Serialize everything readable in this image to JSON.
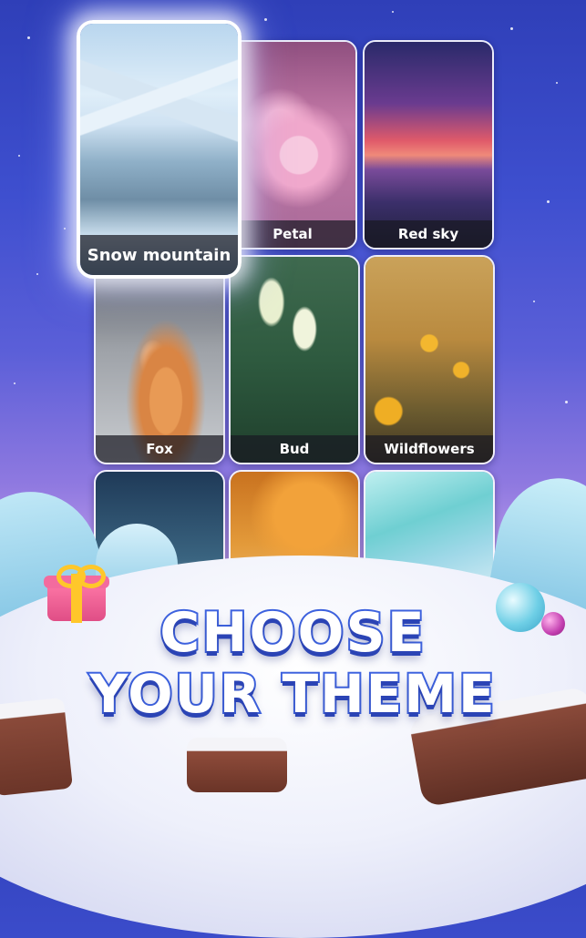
{
  "themes": [
    {
      "label": "Snow mountain",
      "selected": true
    },
    {
      "label": "Petal",
      "selected": false
    },
    {
      "label": "Red sky",
      "selected": false
    },
    {
      "label": "Fox",
      "selected": false
    },
    {
      "label": "Bud",
      "selected": false
    },
    {
      "label": "Wildflowers",
      "selected": false
    },
    {
      "label": "",
      "selected": false
    },
    {
      "label": "",
      "selected": false
    },
    {
      "label": "",
      "selected": false
    }
  ],
  "headline": {
    "line1": "CHOOSE",
    "line2": "YOUR THEME"
  },
  "colors": {
    "background_top": "#2f3fb8",
    "background_bottom": "#e9e4f7",
    "title_stroke": "#3e63e0",
    "label_bar": "#19191f"
  }
}
